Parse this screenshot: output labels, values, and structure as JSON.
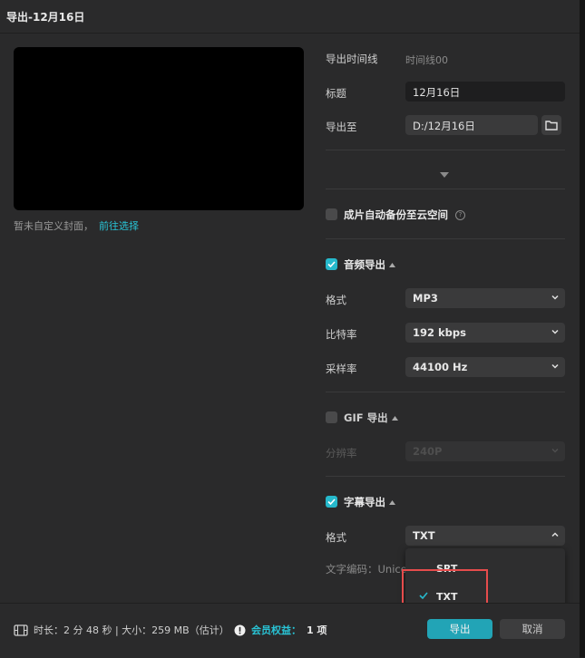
{
  "dialog": {
    "title": "导出-12月16日"
  },
  "cover": {
    "note": "暂未自定义封面，",
    "link": "前往选择"
  },
  "basic": {
    "timeline_label": "导出时间线",
    "timeline_value": "时间线00",
    "title_label": "标题",
    "title_value": "12月16日",
    "path_label": "导出至",
    "path_value": "D:/12月16日"
  },
  "backup": {
    "label": "成片自动备份至云空间",
    "checked": false
  },
  "audio": {
    "label": "音频导出",
    "checked": true,
    "format_label": "格式",
    "format_value": "MP3",
    "bitrate_label": "比特率",
    "bitrate_value": "192 kbps",
    "samplerate_label": "采样率",
    "samplerate_value": "44100 Hz"
  },
  "gif": {
    "label": "GIF 导出",
    "checked": false,
    "resolution_label": "分辨率",
    "resolution_value": "240P"
  },
  "subtitle": {
    "label": "字幕导出",
    "checked": true,
    "format_label": "格式",
    "format_value": "TXT",
    "encoding_label": "文字编码：Unico",
    "options": [
      {
        "label": "SRT",
        "selected": false
      },
      {
        "label": "TXT",
        "selected": true
      }
    ]
  },
  "footer": {
    "duration_label": "时长：2 分 48 秒 | 大小：259 MB（估计）",
    "member_label": "会员权益：",
    "member_value": "1 项",
    "export_button": "导出",
    "cancel_button": "取消"
  },
  "colors": {
    "accent": "#26b9cc",
    "highlight": "#e64c4c"
  }
}
